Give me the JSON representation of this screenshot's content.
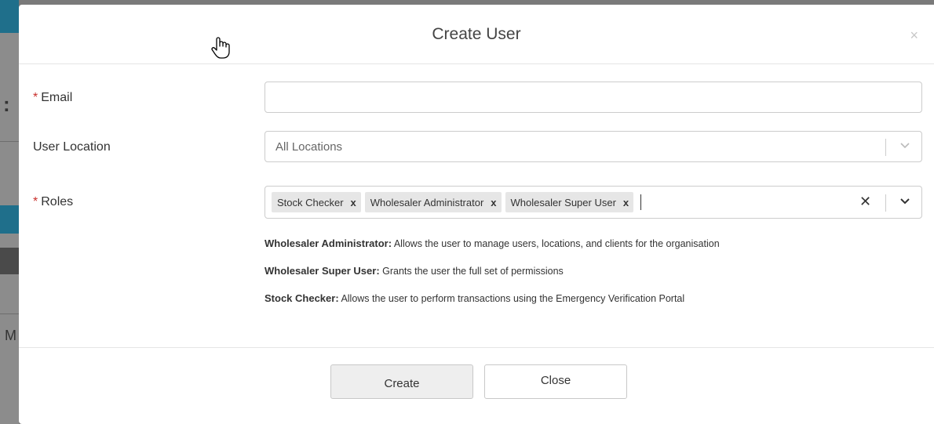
{
  "modal": {
    "title": "Create User",
    "close_symbol": "×"
  },
  "form": {
    "email": {
      "required_mark": "*",
      "label": "Email",
      "value": ""
    },
    "location": {
      "label": "User Location",
      "placeholder": "All Locations"
    },
    "roles": {
      "required_mark": "*",
      "label": "Roles",
      "selected": [
        "Stock Checker",
        "Wholesaler Administrator",
        "Wholesaler Super User"
      ],
      "remove_symbol": "x",
      "clear_symbol": "✕"
    }
  },
  "descriptions": [
    {
      "role": "Wholesaler Administrator:",
      "text": " Allows the user to manage users, locations, and clients for the organisation"
    },
    {
      "role": "Wholesaler Super User:",
      "text": " Grants the user the full set of permissions"
    },
    {
      "role": "Stock Checker:",
      "text": " Allows the user to perform transactions using the Emergency Verification Portal"
    }
  ],
  "footer": {
    "create_label": "Create",
    "close_label": "Close"
  },
  "icons": {
    "chevron": "chevron-down-icon",
    "cursor": "hand-pointer-icon"
  }
}
